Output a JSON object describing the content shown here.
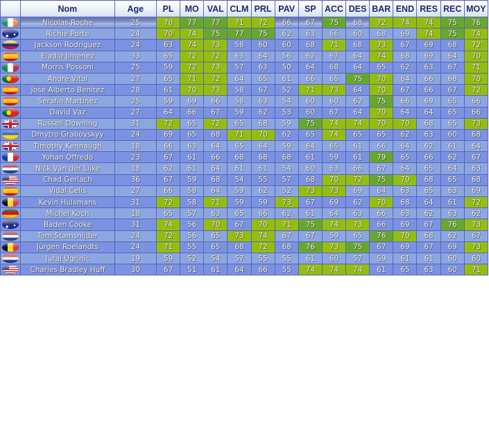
{
  "table": {
    "columns": [
      "",
      "Nom",
      "Age",
      "PL",
      "MO",
      "VAL",
      "CLM",
      "PRL",
      "PAV",
      "SP",
      "ACC",
      "DES",
      "BAR",
      "END",
      "RES",
      "REC",
      "MOY"
    ],
    "colors": {
      "header_text": "#1c2a6c",
      "row_odd": "#7b92e2",
      "row_even": "#8ca6e2",
      "name_text": "#f6e96a",
      "value_text": "#f4f4f4",
      "highlight_70_74": "#94be0e",
      "highlight_75_plus": "#67a82c"
    },
    "selected_row": 0,
    "rows": [
      {
        "flag": "ireland",
        "name": "Nicolas Roche",
        "age": "25",
        "stats": [
          70,
          77,
          77,
          71,
          72,
          66,
          67,
          75,
          68,
          72,
          74,
          74,
          75,
          76
        ]
      },
      {
        "flag": "australia",
        "name": "Richie Porte",
        "age": "24",
        "stats": [
          70,
          74,
          75,
          77,
          75,
          62,
          63,
          66,
          60,
          68,
          69,
          74,
          75,
          74
        ]
      },
      {
        "flag": "venezuela",
        "name": "Jackson Rodríguez",
        "age": "24",
        "stats": [
          63,
          74,
          73,
          58,
          60,
          60,
          68,
          71,
          68,
          73,
          67,
          69,
          68,
          72
        ]
      },
      {
        "flag": "spain",
        "name": "Eladio Jiménez",
        "age": "33",
        "stats": [
          65,
          72,
          72,
          63,
          64,
          56,
          62,
          67,
          64,
          74,
          68,
          69,
          64,
          70
        ]
      },
      {
        "flag": "italy",
        "name": "Morris Possoni",
        "age": "25",
        "stats": [
          59,
          72,
          73,
          57,
          63,
          50,
          64,
          68,
          64,
          65,
          62,
          63,
          67,
          71
        ]
      },
      {
        "flag": "portugal",
        "name": "André Vital",
        "age": "27",
        "stats": [
          65,
          71,
          72,
          64,
          65,
          61,
          66,
          65,
          75,
          70,
          64,
          66,
          68,
          70
        ]
      },
      {
        "flag": "spain",
        "name": "José Alberto Benítez",
        "age": "28",
        "stats": [
          61,
          70,
          73,
          58,
          67,
          52,
          71,
          73,
          64,
          70,
          67,
          66,
          67,
          72
        ]
      },
      {
        "flag": "spain",
        "name": "Serafín Martínez",
        "age": "25",
        "stats": [
          59,
          69,
          66,
          58,
          63,
          54,
          60,
          60,
          62,
          75,
          66,
          69,
          65,
          66
        ]
      },
      {
        "flag": "portugal",
        "name": "David Vaz",
        "age": "27",
        "stats": [
          64,
          66,
          67,
          59,
          62,
          53,
          60,
          67,
          64,
          70,
          64,
          64,
          65,
          66
        ]
      },
      {
        "flag": "uk",
        "name": "Russell Downing",
        "age": "31",
        "stats": [
          72,
          65,
          72,
          65,
          68,
          59,
          75,
          74,
          74,
          70,
          70,
          68,
          65,
          73
        ]
      },
      {
        "flag": "ukraine",
        "name": "Dmytro Grabovskyy",
        "age": "24",
        "stats": [
          69,
          65,
          68,
          71,
          70,
          62,
          65,
          74,
          65,
          65,
          62,
          63,
          60,
          68
        ]
      },
      {
        "flag": "uk",
        "name": "Timothy Kennaugh",
        "age": "18",
        "stats": [
          66,
          63,
          64,
          65,
          64,
          59,
          64,
          65,
          61,
          66,
          64,
          62,
          61,
          64
        ]
      },
      {
        "flag": "france",
        "name": "Yohan Offredo",
        "age": "23",
        "stats": [
          67,
          61,
          66,
          68,
          68,
          68,
          61,
          59,
          61,
          79,
          65,
          66,
          62,
          67
        ]
      },
      {
        "flag": "netherlands",
        "name": "Nick Van der Lijke",
        "age": "18",
        "stats": [
          62,
          61,
          64,
          61,
          61,
          54,
          60,
          63,
          66,
          67,
          64,
          65,
          64,
          63
        ]
      },
      {
        "flag": "usa",
        "name": "Chad Gerlach",
        "age": "36",
        "stats": [
          67,
          59,
          68,
          54,
          55,
          57,
          68,
          70,
          72,
          75,
          70,
          68,
          65,
          68
        ]
      },
      {
        "flag": "spain",
        "name": "Vidal Celis",
        "age": "27",
        "stats": [
          66,
          58,
          64,
          59,
          62,
          52,
          73,
          73,
          69,
          64,
          63,
          65,
          63,
          69
        ]
      },
      {
        "flag": "belgium",
        "name": "Kevin Hulsmans",
        "age": "31",
        "stats": [
          72,
          58,
          71,
          59,
          59,
          73,
          67,
          69,
          62,
          70,
          68,
          64,
          61,
          72
        ]
      },
      {
        "flag": "germany",
        "name": "Michel Koch",
        "age": "18",
        "stats": [
          65,
          57,
          63,
          65,
          66,
          62,
          61,
          64,
          63,
          66,
          63,
          62,
          63,
          62
        ]
      },
      {
        "flag": "australia",
        "name": "Baden Cooke",
        "age": "31",
        "stats": [
          74,
          56,
          70,
          67,
          70,
          71,
          75,
          74,
          73,
          66,
          69,
          67,
          76,
          73
        ]
      },
      {
        "flag": "netherlands",
        "name": "Tom Stamsnijder",
        "age": "24",
        "stats": [
          72,
          56,
          65,
          73,
          74,
          67,
          67,
          59,
          65,
          76,
          70,
          68,
          62,
          67
        ]
      },
      {
        "flag": "belgium",
        "name": "Jürgen Roelandts",
        "age": "24",
        "stats": [
          71,
          55,
          65,
          68,
          72,
          68,
          76,
          73,
          75,
          67,
          69,
          67,
          69,
          73
        ]
      },
      {
        "flag": "croatia",
        "name": "Juraj Ugrinic",
        "age": "19",
        "stats": [
          59,
          52,
          54,
          57,
          55,
          55,
          61,
          60,
          57,
          59,
          61,
          61,
          60,
          60
        ]
      },
      {
        "flag": "usa",
        "name": "Charles Bradley Huff",
        "age": "30",
        "stats": [
          67,
          51,
          61,
          64,
          66,
          55,
          74,
          74,
          74,
          61,
          65,
          63,
          60,
          71
        ]
      }
    ]
  }
}
